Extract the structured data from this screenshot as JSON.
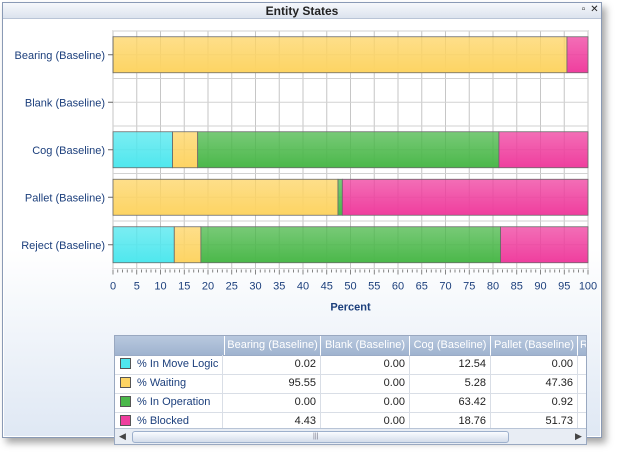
{
  "window": {
    "title": "Entity States",
    "restore_glyph": "▫",
    "close_glyph": "✕"
  },
  "colors": {
    "in_move_logic": "#4fe7ee",
    "waiting": "#fdd463",
    "in_operation": "#4bb84a",
    "blocked": "#ef3e9e",
    "label_text": "#1c3f7c"
  },
  "chart_data": {
    "type": "bar",
    "orientation": "horizontal",
    "stacked": true,
    "categories": [
      "Bearing (Baseline)",
      "Blank (Baseline)",
      "Cog (Baseline)",
      "Pallet (Baseline)",
      "Reject (Baseline)"
    ],
    "series": [
      {
        "name": "% In Move Logic",
        "values": [
          0.02,
          0.0,
          12.54,
          0.0,
          12.9
        ]
      },
      {
        "name": "% Waiting",
        "values": [
          95.55,
          0.0,
          5.28,
          47.36,
          5.6
        ]
      },
      {
        "name": "% In Operation",
        "values": [
          0.0,
          0.0,
          63.42,
          0.92,
          63.1
        ]
      },
      {
        "name": "% Blocked",
        "values": [
          4.43,
          0.0,
          18.76,
          51.73,
          18.4
        ]
      }
    ],
    "xlabel": "Percent",
    "xlim": [
      0,
      100
    ],
    "xticks": [
      "0",
      "5",
      "10",
      "15",
      "20",
      "25",
      "30",
      "35",
      "40",
      "45",
      "50",
      "55",
      "60",
      "65",
      "70",
      "75",
      "80",
      "85",
      "90",
      "95",
      "100"
    ],
    "grid": true
  },
  "grid": {
    "columns": [
      "Bearing (Baseline)",
      "Blank (Baseline)",
      "Cog (Baseline)",
      "Pallet (Baseline)",
      "Re"
    ],
    "rows": [
      {
        "label": "% In Move Logic",
        "values": [
          "0.02",
          "0.00",
          "12.54",
          "0.00"
        ]
      },
      {
        "label": "% Waiting",
        "values": [
          "95.55",
          "0.00",
          "5.28",
          "47.36"
        ]
      },
      {
        "label": "% In Operation",
        "values": [
          "0.00",
          "0.00",
          "63.42",
          "0.92"
        ]
      },
      {
        "label": "% Blocked",
        "values": [
          "4.43",
          "0.00",
          "18.76",
          "51.73"
        ]
      }
    ]
  },
  "scrollbar": {
    "left_glyph": "◀",
    "right_glyph": "▶",
    "grip": "|||"
  }
}
